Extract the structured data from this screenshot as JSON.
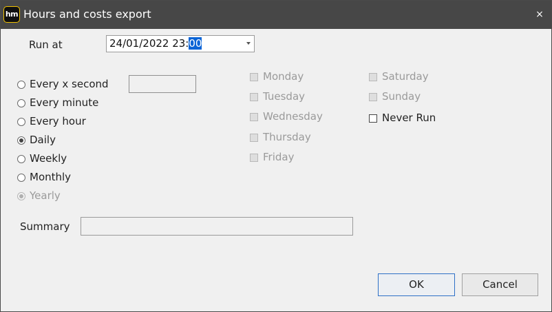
{
  "window": {
    "title": "Hours and costs export",
    "app_icon_text": "hm",
    "close_glyph": "×"
  },
  "run_at": {
    "label": "Run at",
    "value_prefix": "24/01/2022 23:",
    "value_selected": "00"
  },
  "frequency": {
    "options": [
      {
        "label": "Every x second",
        "checked": false,
        "enabled": true
      },
      {
        "label": "Every minute",
        "checked": false,
        "enabled": true
      },
      {
        "label": "Every hour",
        "checked": false,
        "enabled": true
      },
      {
        "label": "Daily",
        "checked": true,
        "enabled": true
      },
      {
        "label": "Weekly",
        "checked": false,
        "enabled": true
      },
      {
        "label": "Monthly",
        "checked": false,
        "enabled": true
      },
      {
        "label": "Yearly",
        "checked": true,
        "enabled": false
      }
    ],
    "seconds_value": ""
  },
  "days": {
    "items": [
      {
        "label": "Monday",
        "checked": false,
        "enabled": false
      },
      {
        "label": "Tuesday",
        "checked": false,
        "enabled": false
      },
      {
        "label": "Wednesday",
        "checked": false,
        "enabled": false
      },
      {
        "label": "Thursday",
        "checked": false,
        "enabled": false
      },
      {
        "label": "Friday",
        "checked": false,
        "enabled": false
      },
      {
        "label": "Saturday",
        "checked": false,
        "enabled": false
      },
      {
        "label": "Sunday",
        "checked": false,
        "enabled": false
      }
    ],
    "never_run": {
      "label": "Never Run",
      "checked": false,
      "enabled": true
    }
  },
  "summary": {
    "label": "Summary",
    "value": ""
  },
  "buttons": {
    "ok": "OK",
    "cancel": "Cancel"
  },
  "colors": {
    "titlebar": "#474747",
    "selection": "#0a64d6",
    "ok_border": "#2d6fc6",
    "disabled_text": "#9a9a9a"
  }
}
